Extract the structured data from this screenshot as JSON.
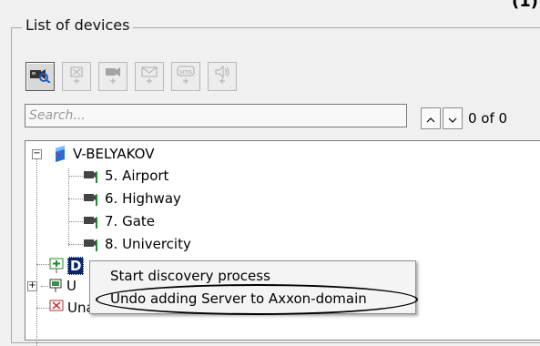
{
  "window": {
    "corner_label": "(1)"
  },
  "panel": {
    "title": "List of devices"
  },
  "toolbar": {
    "buttons": [
      {
        "icon": "camera-search-icon",
        "state": "active"
      },
      {
        "icon": "add-sensor-icon",
        "state": "disabled"
      },
      {
        "icon": "add-camera-icon",
        "state": "disabled"
      },
      {
        "icon": "add-email-icon",
        "state": "disabled"
      },
      {
        "icon": "add-sms-icon",
        "state": "disabled",
        "text": "sms"
      },
      {
        "icon": "add-speaker-icon",
        "state": "disabled"
      }
    ]
  },
  "search": {
    "placeholder": "Search...",
    "value": ""
  },
  "navigation": {
    "counter": "0 of 0"
  },
  "tree": {
    "server": {
      "label": "V-BELYAKOV",
      "expanded": true
    },
    "cameras": [
      {
        "label": "5. Airport"
      },
      {
        "label": "6. Highway"
      },
      {
        "label": "7. Gate"
      },
      {
        "label": "8. Univercity"
      }
    ],
    "selected_node_label": "D",
    "third_node_label": "U",
    "unallocated_label": "Unallocated Servers"
  },
  "context_menu": {
    "items": [
      {
        "label": "Start discovery process"
      },
      {
        "label": "Undo adding Server to Axxon-domain"
      }
    ]
  },
  "colors": {
    "accent_green": "#1f8a2b",
    "selection_blue": "#0a246a",
    "server_blue": "#1e6fd9"
  }
}
